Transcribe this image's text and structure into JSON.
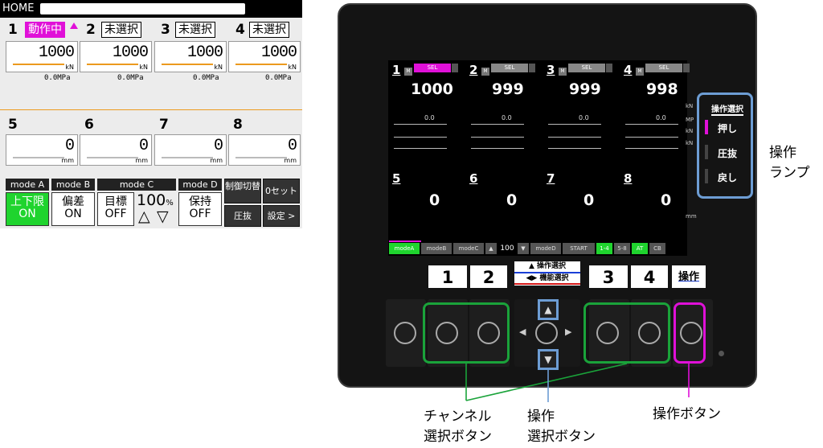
{
  "hmi": {
    "title": "HOME",
    "channels_top": [
      {
        "num": "1",
        "state": "動作中",
        "active": true,
        "value": "1000",
        "unit": "kN",
        "pressure": "0.0MPa"
      },
      {
        "num": "2",
        "state": "未選択",
        "active": false,
        "value": "1000",
        "unit": "kN",
        "pressure": "0.0MPa"
      },
      {
        "num": "3",
        "state": "未選択",
        "active": false,
        "value": "1000",
        "unit": "kN",
        "pressure": "0.0MPa"
      },
      {
        "num": "4",
        "state": "未選択",
        "active": false,
        "value": "1000",
        "unit": "kN",
        "pressure": "0.0MPa"
      }
    ],
    "channels_bottom": [
      {
        "num": "5",
        "value": "0",
        "unit": "mm"
      },
      {
        "num": "6",
        "value": "0",
        "unit": "mm"
      },
      {
        "num": "7",
        "value": "0",
        "unit": "mm"
      },
      {
        "num": "8",
        "value": "0",
        "unit": "mm"
      }
    ],
    "modes": {
      "a": {
        "head": "mode A",
        "line1": "上下限",
        "line2": "ON"
      },
      "b": {
        "head": "mode B",
        "line1": "偏差",
        "line2": "ON"
      },
      "c": {
        "head": "mode C",
        "line1": "目標",
        "line2": "OFF",
        "percent": "100",
        "percent_unit": "%",
        "up": "△",
        "down": "▽"
      },
      "d": {
        "head": "mode D",
        "line1": "保持",
        "line2": "OFF"
      }
    },
    "side_buttons": {
      "control_switch": "制御切替",
      "zero_set": "0セット",
      "press_release": "圧抜",
      "settings": "設定 >"
    },
    "colors": {
      "active": "#e010d8",
      "green": "#1fd42e",
      "orange": "#ec9a1e"
    }
  },
  "device": {
    "lcd": {
      "channels_top": [
        {
          "num": "1",
          "m": "M",
          "sel": "SEL",
          "active": true,
          "value": "1000",
          "sub": "0.0"
        },
        {
          "num": "2",
          "m": "M",
          "sel": "SEL",
          "active": false,
          "value": "999",
          "sub": "0.0"
        },
        {
          "num": "3",
          "m": "M",
          "sel": "SEL",
          "active": false,
          "value": "999",
          "sub": "0.0"
        },
        {
          "num": "4",
          "m": "M",
          "sel": "SEL",
          "active": false,
          "value": "998",
          "sub": "0.0"
        }
      ],
      "channels_bottom": [
        {
          "num": "5",
          "value": "0"
        },
        {
          "num": "6",
          "value": "0"
        },
        {
          "num": "7",
          "value": "0"
        },
        {
          "num": "8",
          "value": "0"
        }
      ],
      "units": {
        "kn1": "kN",
        "mp": "MP",
        "kn2": "kN",
        "kn3": "kN",
        "mm": "mm"
      },
      "footer": [
        {
          "label": "modeA",
          "green": true
        },
        {
          "label": "modeB",
          "green": false
        },
        {
          "label": "modeC",
          "green": false
        },
        {
          "label": "▲",
          "green": false
        },
        {
          "label": "100",
          "green": false
        },
        {
          "label": "▼",
          "green": false
        },
        {
          "label": "modeD",
          "green": false
        },
        {
          "label": "START",
          "green": false
        },
        {
          "label": "1-4",
          "green": true
        },
        {
          "label": "5-8",
          "green": false
        },
        {
          "label": "AT",
          "green": true
        },
        {
          "label": "CB",
          "green": false
        }
      ]
    },
    "op_lamp": {
      "title": "操作選択",
      "items": [
        "押し",
        "圧抜",
        "戻し"
      ]
    },
    "keycaps": {
      "k1": "1",
      "k2": "2",
      "k3": "3",
      "k4": "4",
      "op": "操作"
    },
    "select_cap": {
      "line1": "▲ 操作選択",
      "line2": "◀▶ 機能選択"
    },
    "dpad": {
      "up": "▲",
      "down": "▼",
      "left": "◀",
      "right": "▶"
    }
  },
  "annotations": {
    "op_lamp_line1": "操作",
    "op_lamp_line2": "ランプ",
    "channel_line1": "チャンネル",
    "channel_line2": "選択ボタン",
    "opsel_line1": "操作",
    "opsel_line2": "選択ボタン",
    "op_button": "操作ボタン"
  },
  "annotation_colors": {
    "green": "#1aa33a",
    "blue": "#6d9dd4",
    "magenta": "#e010d8"
  }
}
